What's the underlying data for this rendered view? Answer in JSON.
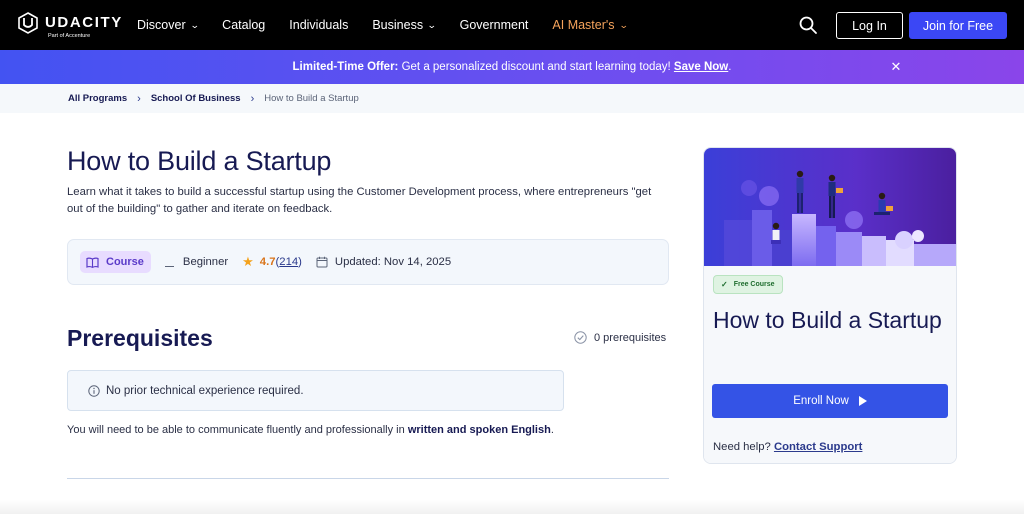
{
  "nav": {
    "brand": "UDACITY",
    "brand_sub": "Part of Accenture",
    "links": [
      {
        "label": "Discover",
        "has_chevron": true
      },
      {
        "label": "Catalog",
        "has_chevron": false
      },
      {
        "label": "Individuals",
        "has_chevron": false
      },
      {
        "label": "Business",
        "has_chevron": true
      },
      {
        "label": "Government",
        "has_chevron": false
      },
      {
        "label": "AI Master's",
        "has_chevron": true
      }
    ],
    "login_label": "Log In",
    "join_label": "Join for Free"
  },
  "banner": {
    "lead": "Limited-Time Offer:",
    "text": " Get a personalized discount and start learning today! ",
    "cta": "Save Now",
    "trail": "."
  },
  "breadcrumb": [
    {
      "label": "All Programs"
    },
    {
      "label": "School Of Business"
    },
    {
      "label": "How to Build a Startup"
    }
  ],
  "course": {
    "title": "How to Build a Startup",
    "description": "Learn what it takes to build a successful startup using the Customer Development process, where entrepreneurs \"get out of the building\" to gather and iterate on feedback.",
    "type_label": "Course",
    "level": "Beginner",
    "rating": "4.7",
    "rating_open": " (",
    "rating_count": "214",
    "rating_close": ")",
    "updated": "Updated: Nov 14, 2025"
  },
  "prerequisites": {
    "heading": "Prerequisites",
    "count_label": "0 prerequisites",
    "note": "No prior technical experience required.",
    "english_pre": "You will need to be able to communicate fluently and professionally in ",
    "english_bold": "written and spoken English",
    "english_post": "."
  },
  "card": {
    "badge": "Free Course",
    "title": "How to Build a Startup",
    "enroll_label": "Enroll Now",
    "help_pre": "Need help? ",
    "help_link": "Contact Support"
  },
  "colors": {
    "nav_bg": "#000000",
    "accent": "#3453e6",
    "ai_link": "#f5a35b",
    "banner_from": "#4353f2",
    "banner_to": "#8a45ea"
  }
}
